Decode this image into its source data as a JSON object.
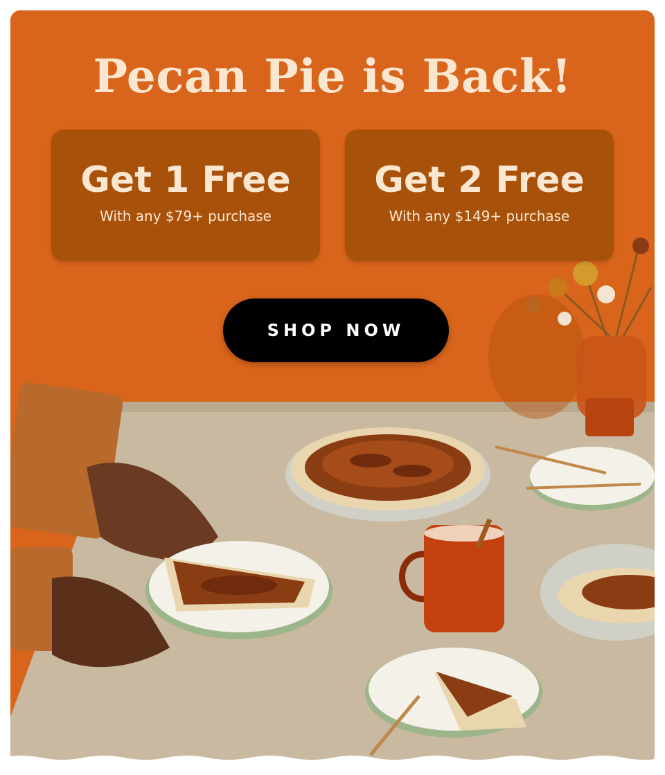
{
  "banner": {
    "title": "Pecan Pie is Back!",
    "offers": [
      {
        "headline": "Get 1 Free",
        "subtext": "With any $79+ purchase"
      },
      {
        "headline": "Get 2 Free",
        "subtext": "With any $149+ purchase"
      }
    ],
    "cta_label": "SHOP NOW"
  },
  "colors": {
    "background": "#d9641b",
    "offer_box": "#a8510a",
    "text_cream": "#fbe6cf",
    "button": "#000000",
    "tablecloth": "#c8b9a0"
  },
  "icons": [
    "pecan-pie-image",
    "pie-slice-image",
    "mug-image",
    "vase-flowers-image",
    "fork-image"
  ]
}
